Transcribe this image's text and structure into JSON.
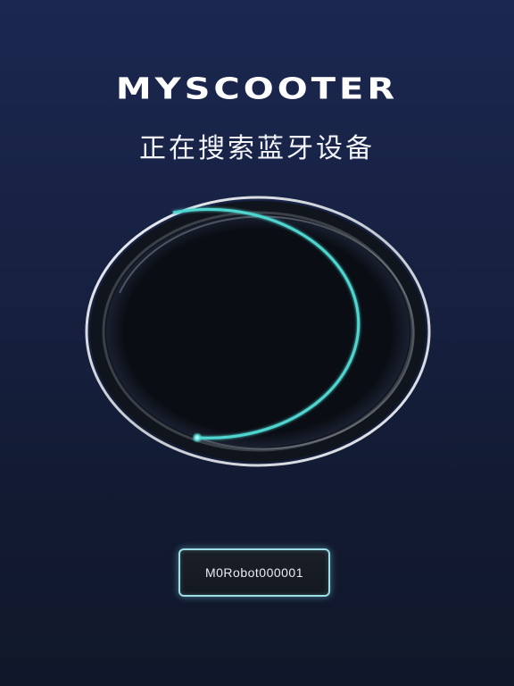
{
  "app": {
    "logo_text": "MYSCOOTER",
    "status_text": "正在搜索蓝牙设备"
  },
  "scanner": {
    "icon": "radar-scan-icon",
    "ring_color": "#d9dde3",
    "arc_color": "#4fd6d0",
    "inner_color": "#080b12"
  },
  "devices": [
    {
      "name": "M0Robot000001"
    }
  ]
}
